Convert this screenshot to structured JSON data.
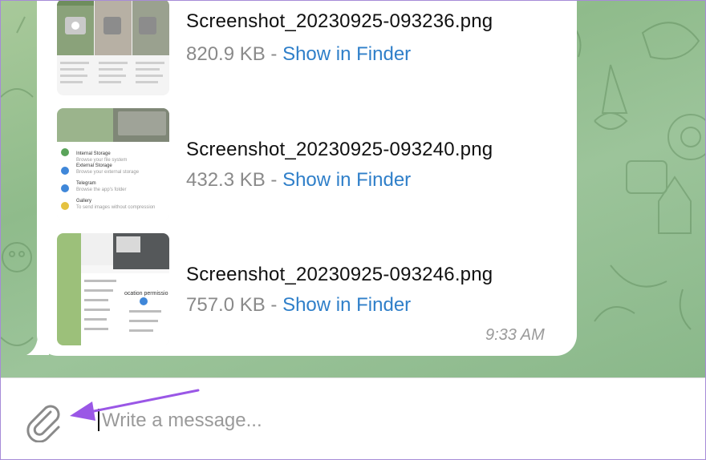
{
  "colors": {
    "accent": "#2f7fc9",
    "annotation_arrow": "#9a57e6",
    "chat_background": "#9cc49a"
  },
  "messages": {
    "files": [
      {
        "name": "Screenshot_20230925-093236.png",
        "size": "820.9 KB",
        "separator": " - ",
        "action": "Show in Finder"
      },
      {
        "name": "Screenshot_20230925-093240.png",
        "size": "432.3 KB",
        "separator": " - ",
        "action": "Show in Finder"
      },
      {
        "name": "Screenshot_20230925-093246.png",
        "size": "757.0 KB",
        "separator": " - ",
        "action": "Show in Finder"
      }
    ],
    "time": "9:33 AM"
  },
  "composer": {
    "placeholder": "Write a message...",
    "attach_icon": "paperclip-icon"
  },
  "thumbnails": {
    "second": {
      "items": [
        {
          "title": "Internal Storage",
          "subtitle": "Browse your file system"
        },
        {
          "title": "External Storage",
          "subtitle": "Browse your external storage"
        },
        {
          "title": "Telegram",
          "subtitle": "Browse the app's folder"
        },
        {
          "title": "Gallery",
          "subtitle": "To send images without compression"
        }
      ]
    },
    "third": {
      "heading": "ocation permissio"
    }
  }
}
